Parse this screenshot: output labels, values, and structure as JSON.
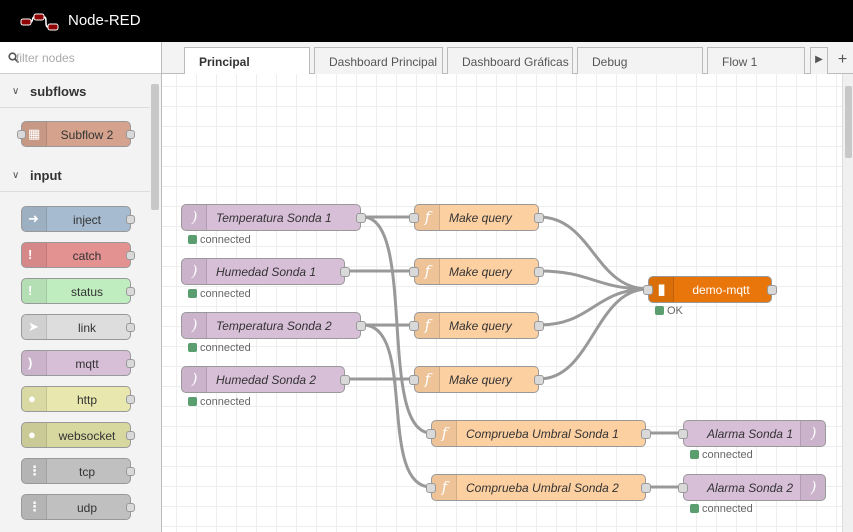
{
  "header": {
    "title": "Node-RED"
  },
  "palette": {
    "search_placeholder": "filter nodes",
    "categories": [
      {
        "label": "subflows",
        "nodes": [
          {
            "label": "Subflow 2",
            "color": "#d4a28d",
            "icon": "subflow-icon"
          }
        ]
      },
      {
        "label": "input",
        "nodes": [
          {
            "label": "inject",
            "color": "#a6bbcf",
            "icon": "arrow-in-icon"
          },
          {
            "label": "catch",
            "color": "#e49191",
            "icon": "exclamation-icon"
          },
          {
            "label": "status",
            "color": "#c0edc0",
            "icon": "exclamation-icon"
          },
          {
            "label": "link",
            "color": "#dddddd",
            "icon": "link-icon"
          },
          {
            "label": "mqtt",
            "color": "#d8bfd8",
            "icon": "bridge-icon"
          },
          {
            "label": "http",
            "color": "#e7e7ae",
            "icon": "globe-icon"
          },
          {
            "label": "websocket",
            "color": "#d7d7a0",
            "icon": "globe-icon"
          },
          {
            "label": "tcp",
            "color": "#c0c0c0",
            "icon": "bridge-icon"
          },
          {
            "label": "udp",
            "color": "#c0c0c0",
            "icon": "bridge-icon"
          }
        ]
      }
    ]
  },
  "tabs": [
    {
      "label": "Principal",
      "active": true
    },
    {
      "label": "Dashboard Principal",
      "active": false
    },
    {
      "label": "Dashboard Gráficas",
      "active": false
    },
    {
      "label": "Debug",
      "active": false
    },
    {
      "label": "Flow 1",
      "active": false
    }
  ],
  "flow": {
    "nodes": [
      {
        "label": "Temperatura Sonda 1",
        "type": "mqtt in",
        "status": "connected"
      },
      {
        "label": "Humedad Sonda 1",
        "type": "mqtt in",
        "status": "connected"
      },
      {
        "label": "Temperatura Sonda 2",
        "type": "mqtt in",
        "status": "connected"
      },
      {
        "label": "Humedad Sonda 2",
        "type": "mqtt in",
        "status": "connected"
      },
      {
        "label": "Make query",
        "type": "function"
      },
      {
        "label": "Make query",
        "type": "function"
      },
      {
        "label": "Make query",
        "type": "function"
      },
      {
        "label": "Make query",
        "type": "function"
      },
      {
        "label": "demo-mqtt",
        "type": "database",
        "status": "OK"
      },
      {
        "label": "Comprueba Umbral Sonda 1",
        "type": "function"
      },
      {
        "label": "Comprueba Umbral Sonda 2",
        "type": "function"
      },
      {
        "label": "Alarma Sonda 1",
        "type": "mqtt out",
        "status": "connected"
      },
      {
        "label": "Alarma Sonda 2",
        "type": "mqtt out",
        "status": "connected"
      }
    ]
  },
  "colors": {
    "mqtt": "#d8bfd8",
    "function": "#fdd0a2",
    "database": "#e8760b",
    "status_ok": "#5a9e6f"
  }
}
